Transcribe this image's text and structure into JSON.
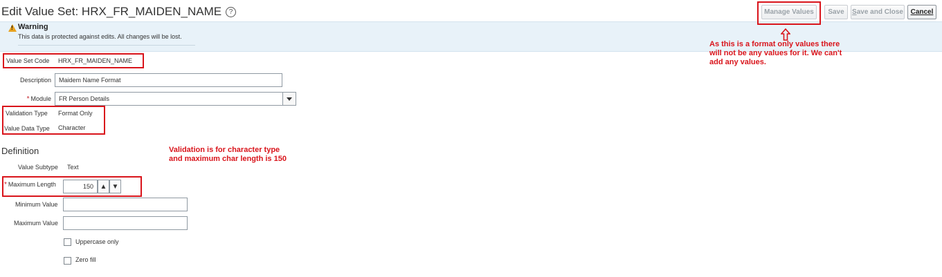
{
  "header": {
    "title": "Edit Value Set: HRX_FR_MAIDEN_NAME",
    "help_icon": "question-circle-icon",
    "buttons": {
      "manage_values": "Manage Values",
      "save": "Save",
      "save_and_close_prefix": "S",
      "save_and_close_rest": "ave and Close",
      "cancel": "Cancel"
    }
  },
  "warning": {
    "icon": "warning-triangle-icon",
    "title": "Warning",
    "message": "This data is protected against edits. All changes will be lost."
  },
  "form": {
    "value_set_code": {
      "label": "Value Set Code",
      "value": "HRX_FR_MAIDEN_NAME"
    },
    "description": {
      "label": "Description",
      "value": "Maidem Name Format"
    },
    "module": {
      "label": "Module",
      "required": "*",
      "value": "FR Person Details"
    },
    "validation_type": {
      "label": "Validation Type",
      "value": "Format Only"
    },
    "value_data_type": {
      "label": "Value Data Type",
      "value": "Character"
    }
  },
  "definition": {
    "heading": "Definition",
    "value_subtype": {
      "label": "Value Subtype",
      "value": "Text"
    },
    "maximum_length": {
      "label": "Maximum Length",
      "required": "*",
      "value": "150"
    },
    "minimum_value": {
      "label": "Minimum Value",
      "value": ""
    },
    "maximum_value": {
      "label": "Maximum Value",
      "value": ""
    },
    "uppercase_only": {
      "label": "Uppercase only",
      "checked": false
    },
    "zero_fill": {
      "label": "Zero fill",
      "checked": false
    }
  },
  "annotations": {
    "manage_values_note": [
      "As this is a format only values there",
      "will not be any values for it. We can't",
      "add any values."
    ],
    "validation_note": [
      "Validation is for character type",
      "and maximum char length is 150"
    ],
    "color": "#d9141b"
  }
}
